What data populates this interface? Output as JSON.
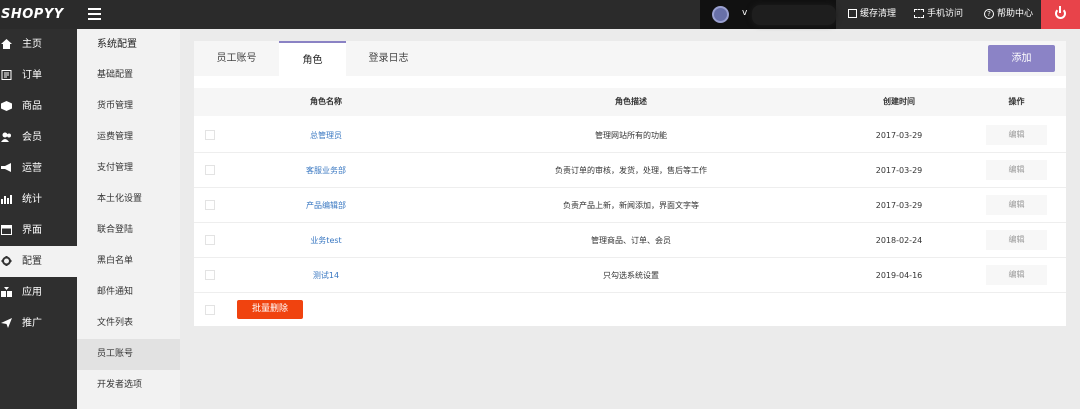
{
  "app": {
    "logo": "SHOPYY"
  },
  "topbar": {
    "user_name": "v",
    "links": [
      {
        "label": "缓存清理",
        "icon": "cache-icon"
      },
      {
        "label": "手机访问",
        "icon": "mobile-scan-icon"
      },
      {
        "label": "帮助中心",
        "icon": "help-icon"
      }
    ],
    "power_icon": "power-icon"
  },
  "nav": {
    "items": [
      {
        "label": "主页",
        "icon": "home-icon"
      },
      {
        "label": "订单",
        "icon": "order-icon"
      },
      {
        "label": "商品",
        "icon": "product-icon"
      },
      {
        "label": "会员",
        "icon": "member-icon"
      },
      {
        "label": "运营",
        "icon": "operation-icon"
      },
      {
        "label": "统计",
        "icon": "stats-icon"
      },
      {
        "label": "界面",
        "icon": "interface-icon"
      },
      {
        "label": "配置",
        "icon": "settings-icon"
      },
      {
        "label": "应用",
        "icon": "apps-icon"
      },
      {
        "label": "推广",
        "icon": "promote-icon"
      }
    ]
  },
  "subnav": {
    "title": "系统配置",
    "items": [
      "基础配置",
      "货币管理",
      "运费管理",
      "支付管理",
      "本土化设置",
      "联合登陆",
      "黑白名单",
      "邮件通知",
      "文件列表",
      "员工账号",
      "开发者选项"
    ]
  },
  "tabs": [
    "员工账号",
    "角色",
    "登录日志"
  ],
  "add_label": "添加",
  "table": {
    "headers": [
      "角色名称",
      "角色描述",
      "创建时间",
      "操作"
    ],
    "rows": [
      {
        "name": "总管理员",
        "desc": "管理网站所有的功能",
        "date": "2017-03-29",
        "action": "编辑"
      },
      {
        "name": "客服业务部",
        "desc": "负责订单的审核，发货，处理，售后等工作",
        "date": "2017-03-29",
        "action": "编辑"
      },
      {
        "name": "产品编辑部",
        "desc": "负责产品上新，新闻添加，界面文字等",
        "date": "2017-03-29",
        "action": "编辑"
      },
      {
        "name": "业务test",
        "desc": "管理商品、订单、会员",
        "date": "2018-02-24",
        "action": "编辑"
      },
      {
        "name": "测试14",
        "desc": "只勾选系统设置",
        "date": "2019-04-16",
        "action": "编辑"
      }
    ]
  },
  "bulk_delete_label": "批量删除"
}
